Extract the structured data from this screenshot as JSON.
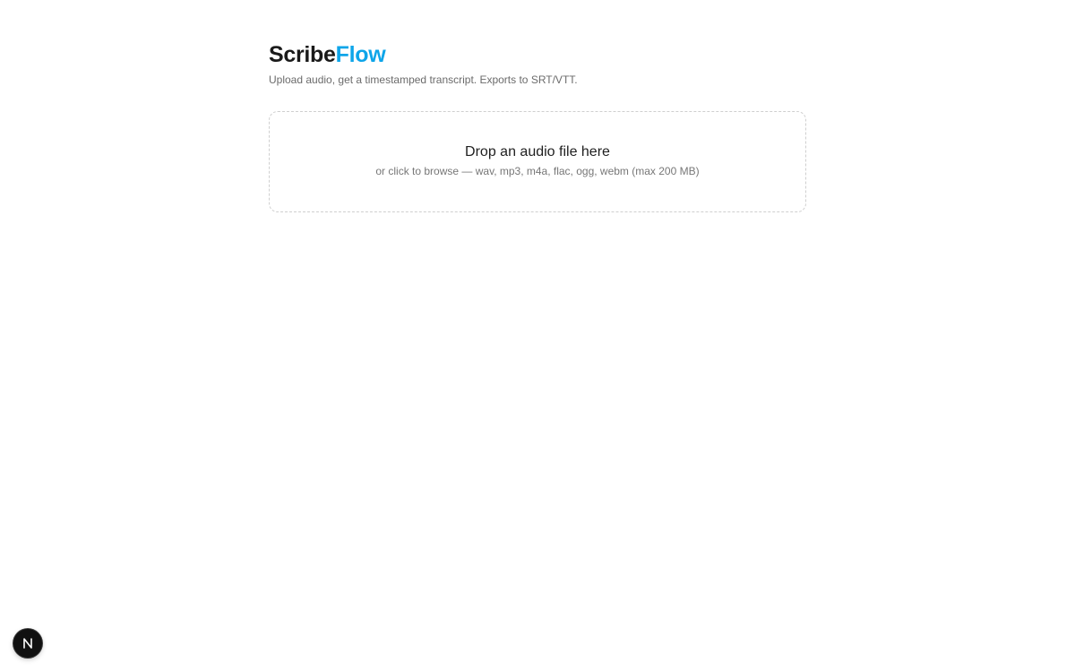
{
  "app": {
    "brand_primary": "Scribe",
    "brand_accent": "Flow",
    "accent_color": "#0ea5e9",
    "subtitle": "Upload audio, get a timestamped transcript. Exports to SRT/VTT."
  },
  "dropzone": {
    "title": "Drop an audio file here",
    "hint": "or click to browse — wav, mp3, m4a, flac, ogg, webm (max 200 MB)"
  },
  "devtools": {
    "icon": "nextjs-n-icon"
  }
}
